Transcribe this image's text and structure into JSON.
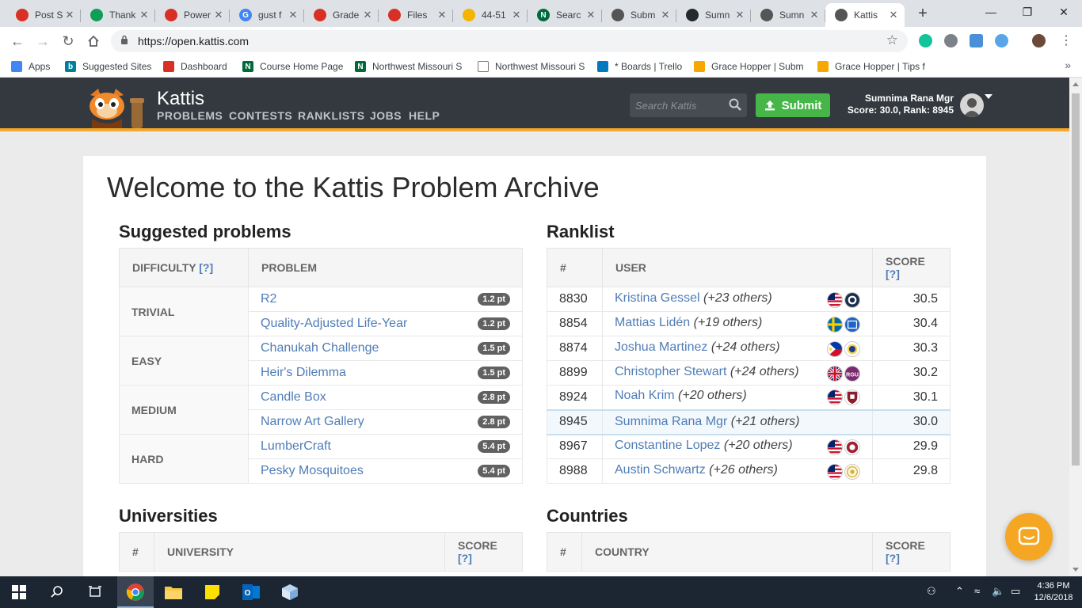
{
  "browser": {
    "tabs": [
      {
        "title": "Post S",
        "color": "#d93025",
        "glyph": ""
      },
      {
        "title": "Thank",
        "color": "#0f9d58",
        "glyph": ""
      },
      {
        "title": "Power",
        "color": "#d93025",
        "glyph": ""
      },
      {
        "title": "gust f",
        "color": "#4285f4",
        "glyph": "G"
      },
      {
        "title": "Grade",
        "color": "#d93025",
        "glyph": ""
      },
      {
        "title": "Files",
        "color": "#d93025",
        "glyph": ""
      },
      {
        "title": "44-51",
        "color": "#f4b400",
        "glyph": ""
      },
      {
        "title": "Searc",
        "color": "#006b3a",
        "glyph": "N"
      },
      {
        "title": "Subm",
        "color": "#555555",
        "glyph": ""
      },
      {
        "title": "Sumn",
        "color": "#24292e",
        "glyph": ""
      },
      {
        "title": "Sumn",
        "color": "#555555",
        "glyph": ""
      },
      {
        "title": "Kattis",
        "color": "#555555",
        "glyph": ""
      }
    ],
    "url": "https://open.kattis.com",
    "window_controls": {
      "minimize": "—",
      "maximize": "❐",
      "close": "✕"
    }
  },
  "bookmarks": [
    {
      "label": "Apps",
      "color": "#4285f4",
      "glyph": ""
    },
    {
      "label": "Suggested Sites",
      "color": "#00809d",
      "glyph": "b"
    },
    {
      "label": "Dashboard",
      "color": "#d93025",
      "glyph": ""
    },
    {
      "label": "Course Home Page",
      "color": "#006b3a",
      "glyph": "N"
    },
    {
      "label": "Northwest Missouri S",
      "color": "#006b3a",
      "glyph": "N"
    },
    {
      "label": "Northwest Missouri S",
      "color": "#ffffff",
      "glyph": ""
    },
    {
      "label": "* Boards | Trello",
      "color": "#0079bf",
      "glyph": ""
    },
    {
      "label": "Grace Hopper | Subm",
      "color": "#f6a800",
      "glyph": ""
    },
    {
      "label": "Grace Hopper | Tips f",
      "color": "#f6a800",
      "glyph": ""
    }
  ],
  "kattis": {
    "brand": "Kattis",
    "nav": [
      "PROBLEMS",
      "CONTESTS",
      "RANKLISTS",
      "JOBS",
      "HELP"
    ],
    "search_placeholder": "Search Kattis",
    "submit_label": "Submit",
    "user_name": "Sumnima Rana Mgr",
    "user_stats": "Score: 30.0, Rank: 8945",
    "accent": "#f2a82c"
  },
  "page": {
    "title": "Welcome to the Kattis Problem Archive",
    "suggested": {
      "heading": "Suggested problems",
      "headers": {
        "difficulty": "DIFFICULTY",
        "difficulty_help": "[?]",
        "problem": "PROBLEM"
      },
      "groups": [
        {
          "difficulty": "TRIVIAL",
          "problems": [
            {
              "name": "R2",
              "points": "1.2 pt"
            },
            {
              "name": "Quality-Adjusted Life-Year",
              "points": "1.2 pt"
            }
          ]
        },
        {
          "difficulty": "EASY",
          "problems": [
            {
              "name": "Chanukah Challenge",
              "points": "1.5 pt"
            },
            {
              "name": "Heir's Dilemma",
              "points": "1.5 pt"
            }
          ]
        },
        {
          "difficulty": "MEDIUM",
          "problems": [
            {
              "name": "Candle Box",
              "points": "2.8 pt"
            },
            {
              "name": "Narrow Art Gallery",
              "points": "2.8 pt"
            }
          ]
        },
        {
          "difficulty": "HARD",
          "problems": [
            {
              "name": "LumberCraft",
              "points": "5.4 pt"
            },
            {
              "name": "Pesky Mosquitoes",
              "points": "5.4 pt"
            }
          ]
        }
      ]
    },
    "ranklist": {
      "heading": "Ranklist",
      "headers": {
        "rank": "#",
        "user": "USER",
        "score": "SCORE",
        "score_help": "[?]"
      },
      "rows": [
        {
          "rank": "8830",
          "user": "Kristina Gessel",
          "others": "(+23 others)",
          "score": "30.5",
          "flags": [
            "us",
            "seal-navy"
          ]
        },
        {
          "rank": "8854",
          "user": "Mattias Lidén",
          "others": "(+19 others)",
          "score": "30.4",
          "flags": [
            "se",
            "square-blue"
          ]
        },
        {
          "rank": "8874",
          "user": "Joshua Martinez",
          "others": "(+24 others)",
          "score": "30.3",
          "flags": [
            "ph",
            "seal-blue"
          ]
        },
        {
          "rank": "8899",
          "user": "Christopher Stewart",
          "others": "(+24 others)",
          "score": "30.2",
          "flags": [
            "gb",
            "rgu"
          ]
        },
        {
          "rank": "8924",
          "user": "Noah Krim",
          "others": "(+20 others)",
          "score": "30.1",
          "flags": [
            "us",
            "shield-red"
          ]
        },
        {
          "rank": "8945",
          "user": "Sumnima Rana Mgr",
          "others": "(+21 others)",
          "score": "30.0",
          "flags": [],
          "me": true
        },
        {
          "rank": "8967",
          "user": "Constantine Lopez",
          "others": "(+20 others)",
          "score": "29.9",
          "flags": [
            "us",
            "seal-red"
          ]
        },
        {
          "rank": "8988",
          "user": "Austin Schwartz",
          "others": "(+26 others)",
          "score": "29.8",
          "flags": [
            "us",
            "seal-gold"
          ]
        }
      ]
    },
    "universities": {
      "heading": "Universities",
      "headers": {
        "rank": "#",
        "name": "UNIVERSITY",
        "score": "SCORE",
        "score_help": "[?]"
      }
    },
    "countries": {
      "heading": "Countries",
      "headers": {
        "rank": "#",
        "name": "COUNTRY",
        "score": "SCORE",
        "score_help": "[?]"
      }
    }
  },
  "taskbar": {
    "time": "4:36 PM",
    "date": "12/6/2018"
  }
}
